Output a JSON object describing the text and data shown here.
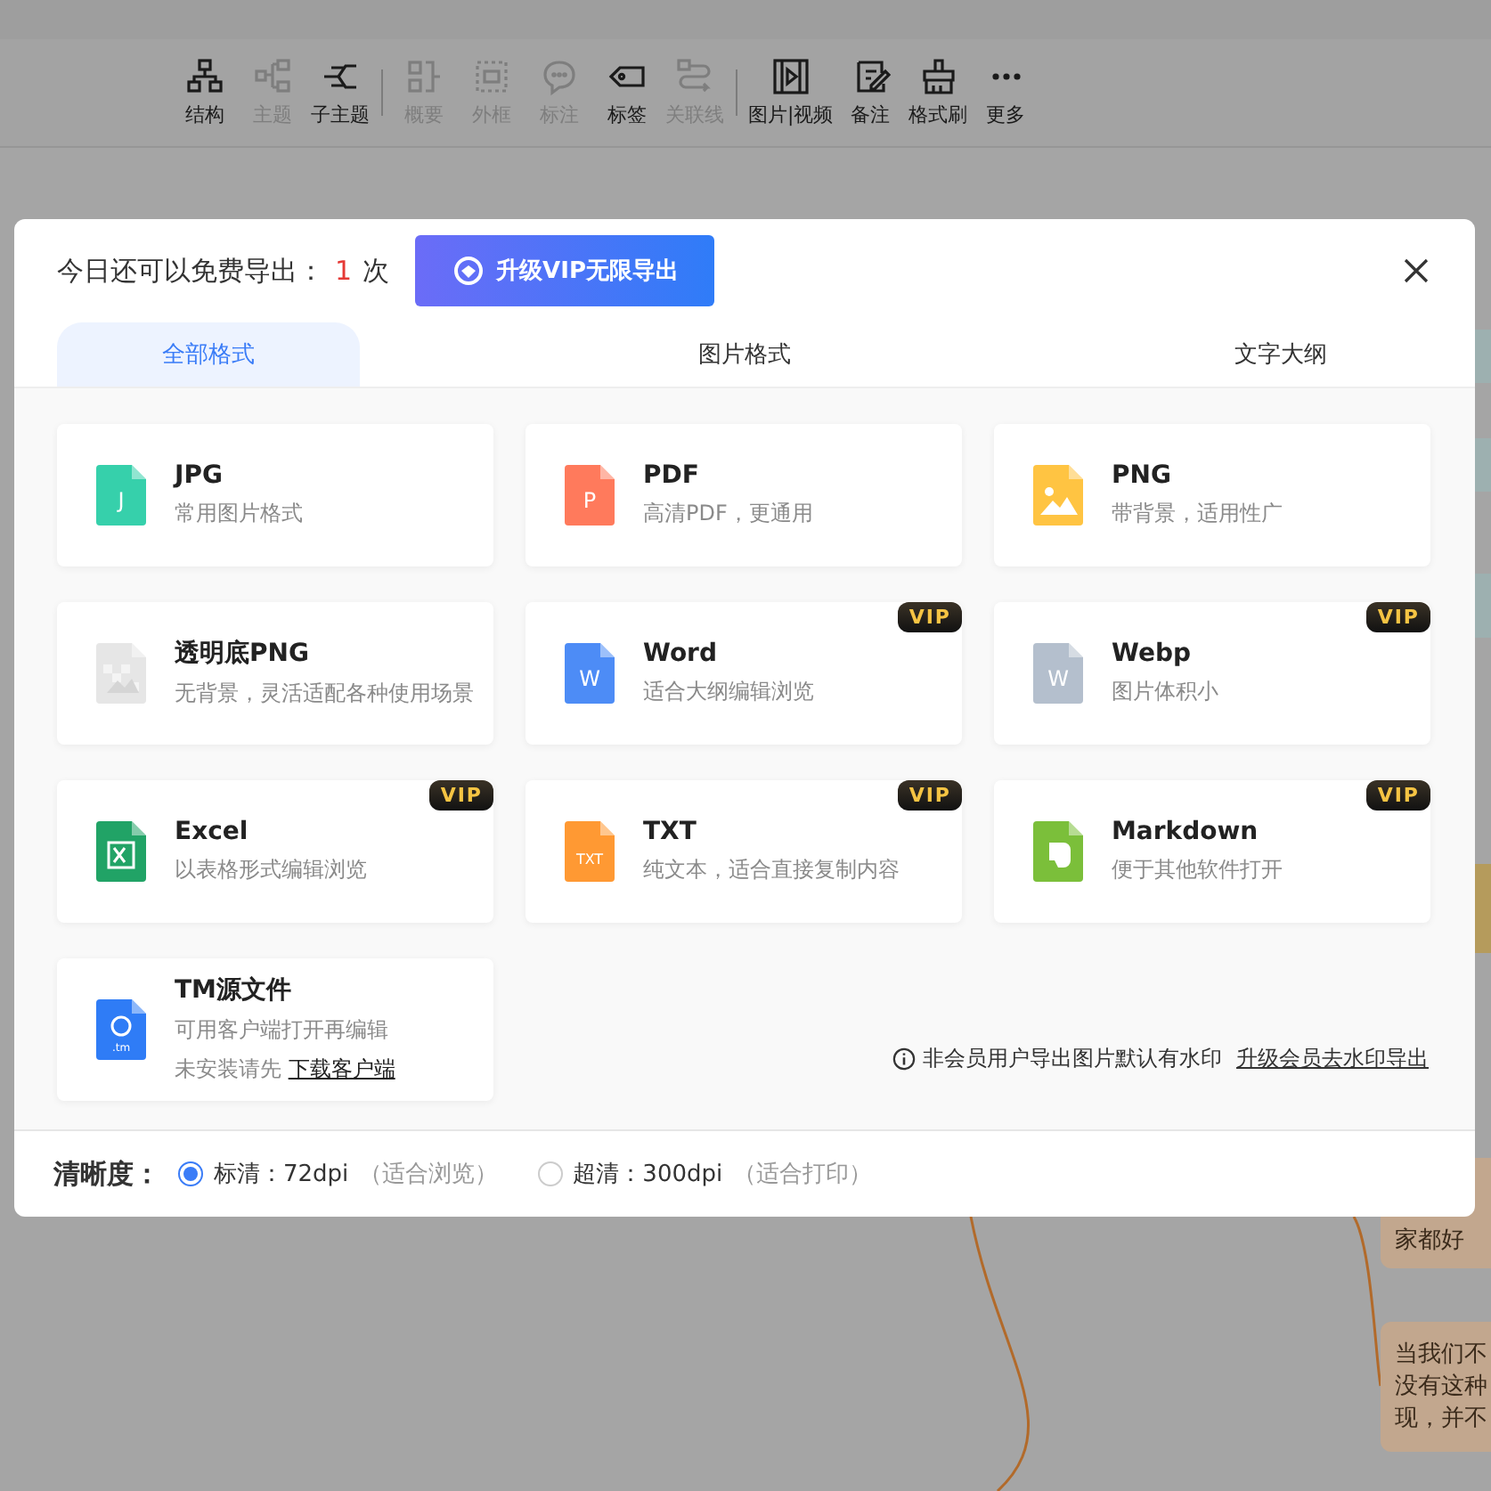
{
  "toolbar": [
    [
      {
        "label": "结构",
        "disabled": false
      },
      {
        "label": "主题",
        "disabled": true
      },
      {
        "label": "子主题",
        "disabled": false
      }
    ],
    [
      {
        "label": "概要",
        "disabled": true
      },
      {
        "label": "外框",
        "disabled": true
      },
      {
        "label": "标注",
        "disabled": true
      },
      {
        "label": "标签",
        "disabled": false
      },
      {
        "label": "关联线",
        "disabled": true
      }
    ],
    [
      {
        "label": "图片|视频",
        "disabled": false
      },
      {
        "label": "备注",
        "disabled": false
      },
      {
        "label": "格式刷",
        "disabled": false
      },
      {
        "label": "更多",
        "disabled": false
      }
    ]
  ],
  "canvas_nodes": [
    {
      "color": "#9db0b0"
    },
    {
      "color": "#9db0b0"
    },
    {
      "color": "#9db0b0"
    },
    {
      "color": "#b59b5c"
    },
    {
      "lines": [
        "家都好"
      ],
      "color": "#c2a78e"
    },
    {
      "lines": [
        "当我们不",
        "没有这种",
        "现，并不"
      ],
      "color": "#c2a78e"
    }
  ],
  "dialog": {
    "quota_prefix": "今日还可以免费导出：",
    "quota_count": "1",
    "quota_suffix": "次",
    "upgrade_button": "升级VIP无限导出",
    "tabs": [
      {
        "label": "全部格式",
        "selected": true
      },
      {
        "label": "图片格式",
        "selected": false
      },
      {
        "label": "文字大纲",
        "selected": false
      }
    ],
    "formats": [
      {
        "title": "JPG",
        "desc": "常用图片格式",
        "kind": "letter",
        "icon_text": "J",
        "color": "#36d0ab"
      },
      {
        "title": "PDF",
        "desc": "高清PDF，更通用",
        "kind": "letter",
        "icon_text": "P",
        "color": "#ff7a5c"
      },
      {
        "title": "PNG",
        "desc": "带背景，适用性广",
        "kind": "image",
        "color": "#ffc442"
      },
      {
        "title": "透明底PNG",
        "desc": "无背景，灵活适配各种使用场景",
        "kind": "transparent",
        "color": "#e6e6e6"
      },
      {
        "title": "Word",
        "desc": "适合大纲编辑浏览",
        "kind": "letter",
        "icon_text": "W",
        "color": "#4d8cf6",
        "badge": "VIP"
      },
      {
        "title": "Webp",
        "desc": "图片体积小",
        "kind": "letter",
        "icon_text": "W",
        "color": "#b4bfcd",
        "badge": "VIP"
      },
      {
        "title": "Excel",
        "desc": "以表格形式编辑浏览",
        "kind": "excel",
        "color": "#21a366",
        "badge": "VIP"
      },
      {
        "title": "TXT",
        "desc": "纯文本，适合直接复制内容",
        "kind": "letter",
        "icon_text": "TXT",
        "color": "#ff9933",
        "badge": "VIP"
      },
      {
        "title": "Markdown",
        "desc": "便于其他软件打开",
        "kind": "leaf",
        "color": "#7bbf3a",
        "badge": "VIP"
      },
      {
        "title": "TM源文件",
        "desc": "可用客户端打开再编辑",
        "kind": "tm",
        "icon_text": ".tm",
        "color": "#2f7cf6",
        "note": "未安装请先",
        "note_link": "下载客户端"
      }
    ],
    "watermark_note": "非会员用户导出图片默认有水印",
    "watermark_link": "升级会员去水印导出",
    "resolution_label": "清晰度：",
    "resolutions": [
      {
        "label": "标清：72dpi",
        "hint": "（适合浏览）",
        "selected": true
      },
      {
        "label": "超清：300dpi",
        "hint": "（适合打印）",
        "selected": false
      }
    ]
  }
}
